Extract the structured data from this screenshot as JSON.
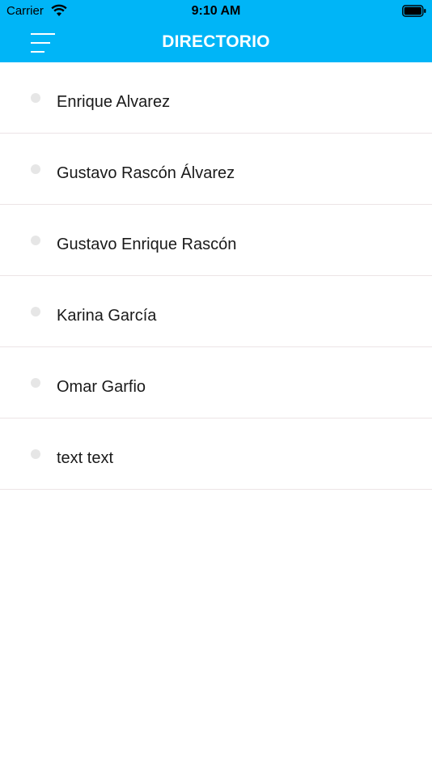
{
  "status_bar": {
    "carrier": "Carrier",
    "time": "9:10 AM",
    "wifi_icon": "wifi-icon",
    "battery_icon": "battery-icon"
  },
  "nav": {
    "title": "DIRECTORIO",
    "menu_icon": "menu-icon"
  },
  "contacts": [
    {
      "name": "Enrique Alvarez"
    },
    {
      "name": "Gustavo Rascón Álvarez"
    },
    {
      "name": "Gustavo Enrique Rascón"
    },
    {
      "name": "Karina García"
    },
    {
      "name": "Omar Garfio"
    },
    {
      "name": "text text"
    }
  ],
  "colors": {
    "header_bg": "#00b5f7",
    "title_text": "#ffffff",
    "divider": "#ece4e6",
    "bullet": "#e6e6e6",
    "item_text": "#1a1a1a"
  }
}
